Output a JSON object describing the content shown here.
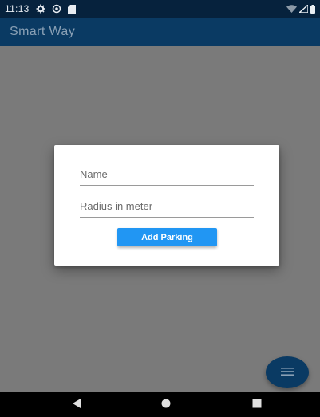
{
  "status_bar": {
    "time": "11:13",
    "icons": [
      "settings-icon",
      "sync-icon",
      "sd-card-icon",
      "wifi-icon",
      "signal-icon",
      "battery-icon"
    ]
  },
  "app_bar": {
    "title": "Smart Way"
  },
  "dialog": {
    "name_field": {
      "placeholder": "Name",
      "value": ""
    },
    "radius_field": {
      "placeholder": "Radius in meter",
      "value": ""
    },
    "add_button_label": "Add Parking"
  },
  "fab": {
    "icon": "menu-lines-icon"
  },
  "nav_bar": {
    "icons": [
      "back-icon",
      "home-icon",
      "recents-icon"
    ]
  },
  "colors": {
    "status_bar": "#06223d",
    "app_bar": "#0a3a63",
    "scrim": "#7a7a7a",
    "button": "#2196f3",
    "fab": "#0a3a63"
  }
}
